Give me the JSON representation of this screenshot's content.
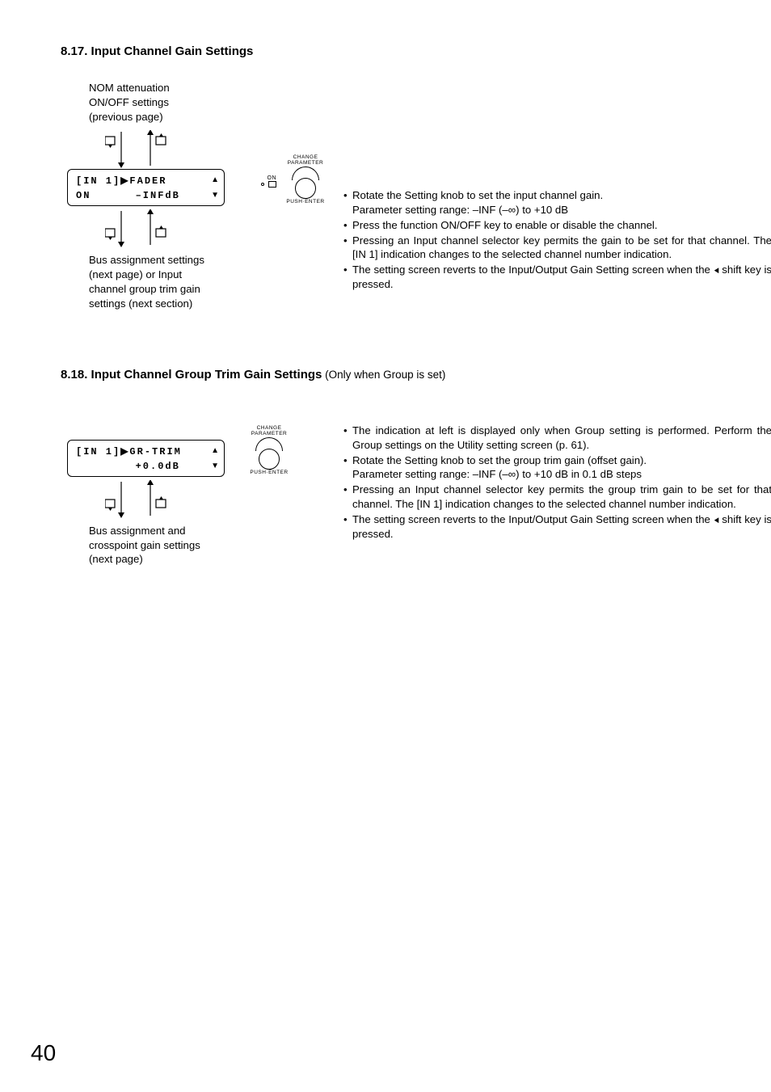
{
  "sec1": {
    "title": "8.17. Input Channel Gain Settings",
    "prev_note_l1": "NOM attenuation",
    "prev_note_l2": "ON/OFF settings",
    "prev_note_l3": "(previous page)",
    "lcd_row1": "[IN 1]▶FADER",
    "lcd_row2": "ON      –INFdB",
    "next_note_l1": "Bus assignment settings",
    "next_note_l2": "(next page) or Input",
    "next_note_l3": "channel group trim gain",
    "next_note_l4": "settings (next section)",
    "knob_top": "CHANGE",
    "knob_mid": "PARAMETER",
    "knob_bottom": "PUSH·ENTER",
    "knob_on": "ON",
    "b1": "Rotate the Setting knob to set the input channel gain.",
    "b1b": "Parameter setting range: –INF (–∞) to +10 dB",
    "b2": "Press the function ON/OFF key to enable or disable the channel.",
    "b3": "Pressing an Input channel selector key permits the gain to be set for that channel. The [IN 1] indication changes to the selected channel number indication.",
    "b4a": "The setting screen reverts to the Input/Output Gain Setting screen when the ",
    "b4b": " shift key is pressed."
  },
  "sec2": {
    "title_a": "8.18. Input Channel Group Trim Gain Settings",
    "title_b": " (Only when Group is set)",
    "lcd_row1": "[IN 1]▶GR-TRIM",
    "lcd_row2": "        +0.0dB",
    "next_note_l1": "Bus assignment and",
    "next_note_l2": "crosspoint gain settings",
    "next_note_l3": "(next page)",
    "knob_top": "CHANGE",
    "knob_mid": "PARAMETER",
    "knob_bottom": "PUSH·ENTER",
    "b1": "The indication at left is displayed only when Group setting is performed. Perform the Group settings on the Utility setting screen (p. 61).",
    "b2": "Rotate the Setting knob to set the group trim gain (offset gain).",
    "b2b": "Parameter setting range: –INF (–∞) to +10 dB in 0.1 dB steps",
    "b3": "Pressing an Input channel selector key permits the group trim gain to be set for that channel. The [IN 1] indication changes to the selected channel number indication.",
    "b4a": "The setting screen reverts to the Input/Output Gain Setting screen when the ",
    "b4b": " shift key is pressed."
  },
  "page_number": "40"
}
